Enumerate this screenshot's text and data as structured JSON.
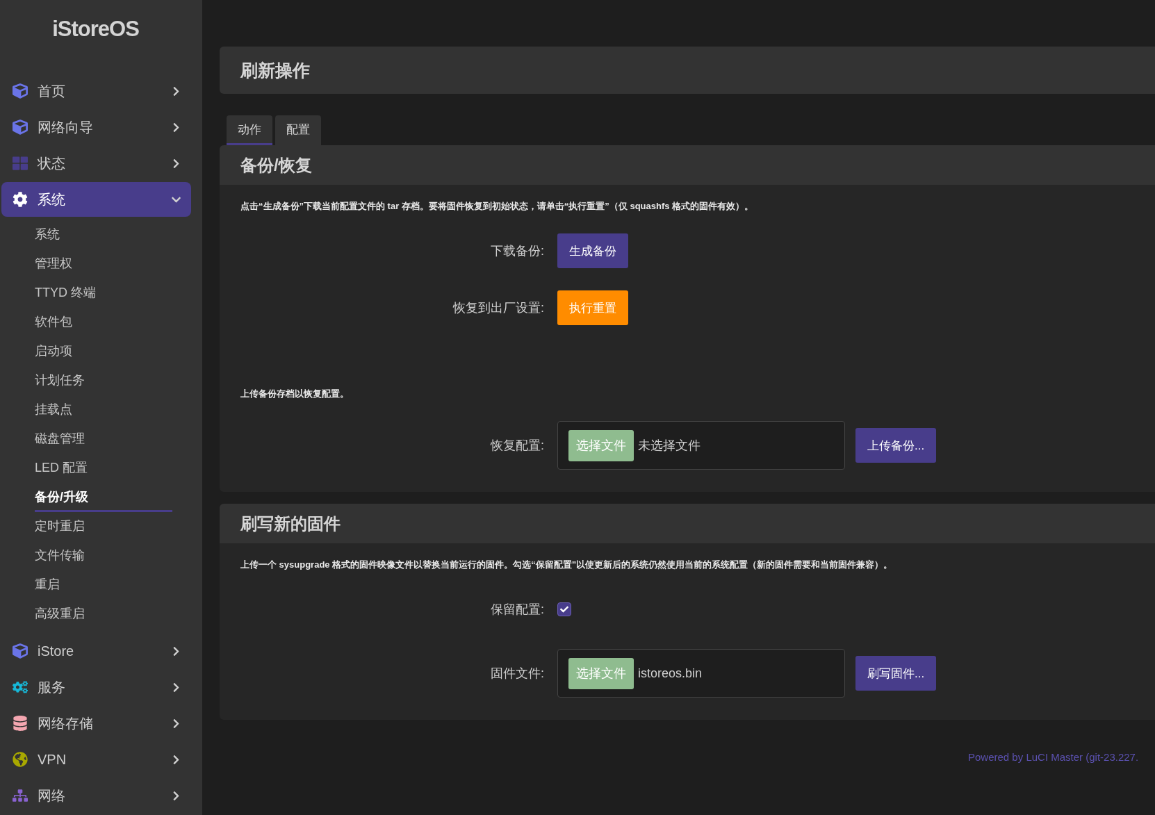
{
  "sidebar": {
    "logo": "iStoreOS",
    "items": [
      {
        "label": "首页",
        "expanded": false,
        "selected": false
      },
      {
        "label": "网络向导",
        "expanded": false,
        "selected": false
      },
      {
        "label": "状态",
        "expanded": false,
        "selected": false
      },
      {
        "label": "系统",
        "expanded": true,
        "selected": true,
        "children": [
          {
            "label": "系统",
            "selected": false
          },
          {
            "label": "管理权",
            "selected": false
          },
          {
            "label": "TTYD 终端",
            "selected": false
          },
          {
            "label": "软件包",
            "selected": false
          },
          {
            "label": "启动项",
            "selected": false
          },
          {
            "label": "计划任务",
            "selected": false
          },
          {
            "label": "挂载点",
            "selected": false
          },
          {
            "label": "磁盘管理",
            "selected": false
          },
          {
            "label": "LED 配置",
            "selected": false
          },
          {
            "label": "备份/升级",
            "selected": true
          },
          {
            "label": "定时重启",
            "selected": false
          },
          {
            "label": "文件传输",
            "selected": false
          },
          {
            "label": "重启",
            "selected": false
          },
          {
            "label": "高级重启",
            "selected": false
          }
        ]
      },
      {
        "label": "iStore",
        "expanded": false,
        "selected": false
      },
      {
        "label": "服务",
        "expanded": false,
        "selected": false
      },
      {
        "label": "网络存储",
        "expanded": false,
        "selected": false
      },
      {
        "label": "VPN",
        "expanded": false,
        "selected": false
      },
      {
        "label": "网络",
        "expanded": false,
        "selected": false
      }
    ]
  },
  "page_title": "刷新操作",
  "tabs": [
    {
      "label": "动作",
      "selected": true
    },
    {
      "label": "配置",
      "selected": false
    }
  ],
  "sections": [
    {
      "title": "备份/恢复",
      "blocks": [
        {
          "kind": "note",
          "text": "点击“生成备份”下载当前配置文件的 tar 存档。要将固件恢复到初始状态，请单击“执行重置”（仅 squashfs 格式的固件有效）。"
        },
        {
          "kind": "button",
          "label": "下载备份:",
          "button": "生成备份",
          "color": "#483d8b"
        },
        {
          "kind": "button",
          "label": "恢复到出厂设置:",
          "button": "执行重置",
          "color": "#ff8c00"
        },
        {
          "kind": "note",
          "text": "上传备份存档以恢复配置。"
        },
        {
          "kind": "file",
          "label": "恢复配置:",
          "choose": "选择文件",
          "file": "未选择文件",
          "button": "上传备份..."
        }
      ]
    },
    {
      "title": "刷写新的固件",
      "blocks": [
        {
          "kind": "note",
          "text": "上传一个 sysupgrade 格式的固件映像文件以替换当前运行的固件。勾选“保留配置”以使更新后的系统仍然使用当前的系统配置（新的固件需要和当前固件兼容）。"
        },
        {
          "kind": "checkbox",
          "label": "保留配置:",
          "checked": true
        },
        {
          "kind": "file",
          "label": "固件文件:",
          "choose": "选择文件",
          "file": "istoreos.bin",
          "button": "刷写固件..."
        }
      ]
    }
  ],
  "footer": "Powered by LuCI Master (git-23.227."
}
